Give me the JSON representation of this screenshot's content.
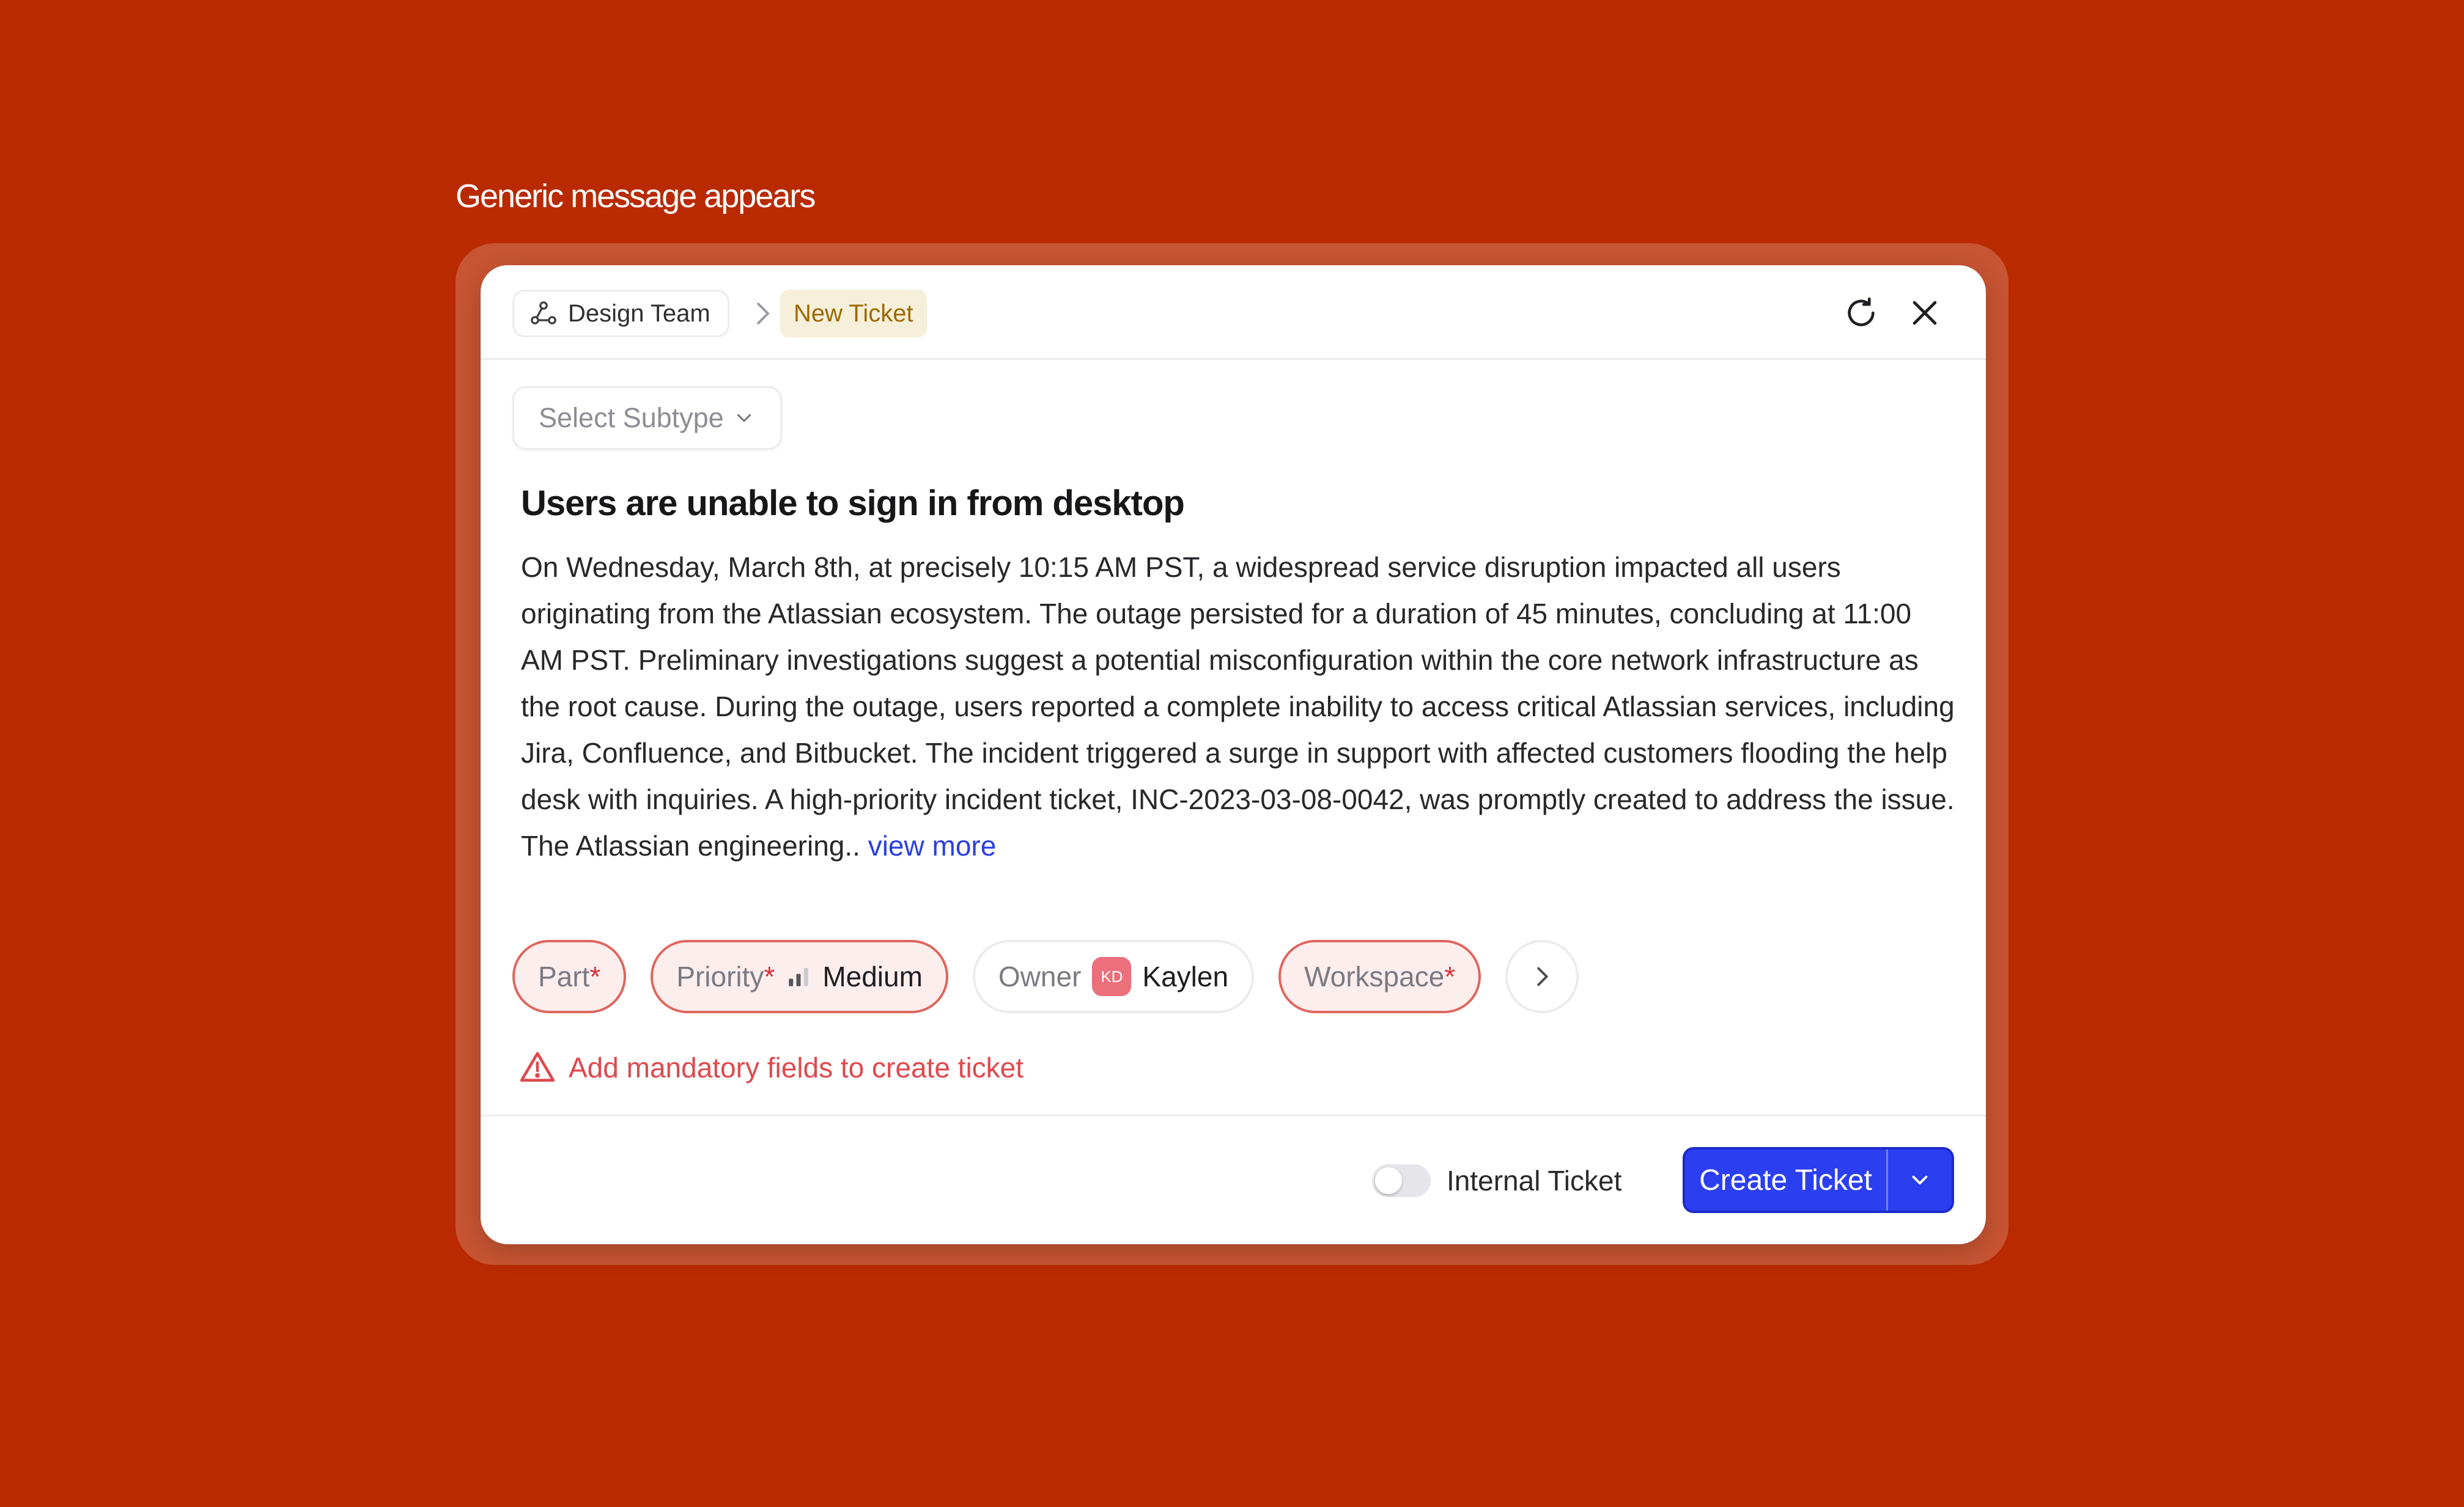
{
  "caption": "Generic message appears",
  "header": {
    "team_label": "Design Team",
    "new_ticket_label": "New Ticket"
  },
  "subtype": {
    "placeholder": "Select Subtype"
  },
  "ticket": {
    "title": "Users are unable to sign in from desktop",
    "body": "On Wednesday, March 8th, at precisely 10:15 AM PST, a widespread service disruption impacted all users originating from the Atlassian ecosystem. The outage persisted for a duration of 45 minutes, concluding at 11:00 AM PST. Preliminary investigations suggest a potential misconfiguration within the core network infrastructure as the root cause. During the outage, users reported a complete inability to access critical Atlassian services, including Jira, Confluence, and Bitbucket. The incident triggered a surge in support with affected customers flooding the help desk with inquiries. A high-priority incident ticket, INC-2023-03-08-0042, was promptly created to address the issue. The Atlassian engineering..",
    "view_more": "view more"
  },
  "fields": {
    "part": {
      "label": "Part",
      "star": "*"
    },
    "priority": {
      "label": "Priority",
      "star": "*",
      "value": "Medium",
      "icon": "signal-bars-icon"
    },
    "owner": {
      "label": "Owner",
      "avatar": "KD",
      "value": "Kaylen",
      "avatar_color": "#ec6f7c"
    },
    "workspace": {
      "label": "Workspace",
      "star": "*"
    }
  },
  "warning": {
    "text": "Add mandatory fields to create ticket",
    "color": "#e0484d"
  },
  "footer": {
    "internal_label": "Internal Ticket",
    "internal_enabled": false,
    "create_label": "Create Ticket"
  },
  "colors": {
    "background": "#b92a00",
    "primary": "#2b3ff0",
    "required": "#d7323a",
    "badge_bg": "#f6efd9",
    "badge_text": "#9a6a00"
  }
}
